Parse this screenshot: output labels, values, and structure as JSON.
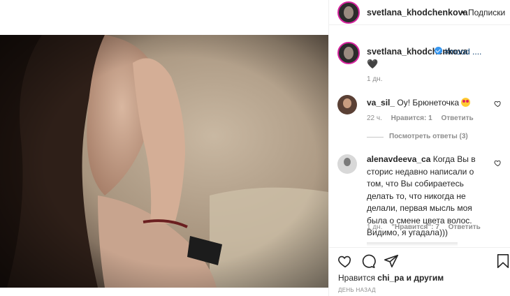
{
  "header": {
    "username": "svetlana_khodchenkova",
    "separator": "•",
    "follow_label": "Подписки"
  },
  "caption": {
    "username": "svetlana_khodchenkova",
    "hashtag": "#mood ....",
    "emoji": "🖤",
    "time": "1 дн."
  },
  "comments": [
    {
      "username": "va_sil_",
      "text": "Оу! Брюнеточка",
      "time": "22 ч.",
      "likes": "Нравится: 1",
      "reply": "Ответить",
      "view_replies": "Посмотреть ответы (3)"
    },
    {
      "username": "alenavdeeva_ca",
      "text": "Когда Вы в сторис недавно написали о том, что Вы собираетесь делать то, что никогда не делали, первая мысль моя была о смене цвета волос. Видимо, я угадала)))",
      "time": "1 дн.",
      "likes": "\"Нравится\": 7",
      "reply": "Ответить"
    }
  ],
  "actions": {
    "liked_by_prefix": "Нравится",
    "liked_by_user": "chi_pa",
    "liked_by_suffix": "и другим",
    "date": "ДЕНЬ НАЗАД"
  },
  "colors": {
    "link": "#00376b",
    "verified": "#3897f0",
    "muted": "#8e8e8e",
    "text": "#262626"
  },
  "icons": [
    "heart-icon",
    "comment-icon",
    "share-icon",
    "bookmark-icon",
    "verified-icon",
    "like-heart-icon"
  ]
}
